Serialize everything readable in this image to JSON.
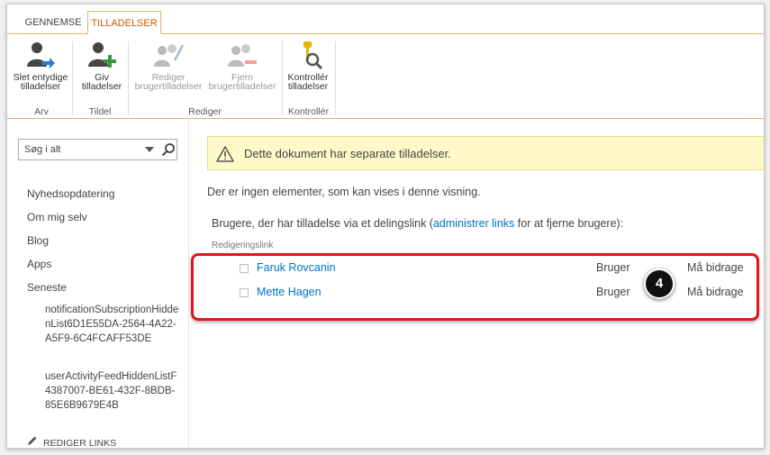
{
  "tabs": [
    {
      "label": "GENNEMSE"
    },
    {
      "label": "TILLADELSER"
    }
  ],
  "ribbon": {
    "buttons": [
      {
        "label": "Slet entydige\ntilladelser",
        "icon": "user-arrow-icon"
      },
      {
        "label": "Giv\ntilladelser",
        "icon": "user-add-icon"
      },
      {
        "label": "Rediger\nbrugertilladelser",
        "icon": "users-edit-icon"
      },
      {
        "label": "Fjern\nbrugertilladelser",
        "icon": "users-remove-icon"
      },
      {
        "label": "Kontrollér\ntilladelser",
        "icon": "key-search-icon"
      }
    ],
    "groups": [
      "Arv",
      "Tildel",
      "Rediger",
      "Kontrollér"
    ]
  },
  "search": {
    "placeholder": "Søg i alt"
  },
  "nav": {
    "items": [
      "Nyhedsopdatering",
      "Om mig selv",
      "Blog",
      "Apps",
      "Seneste"
    ],
    "sub_items": [
      "notificationSubscriptionHiddenList6D1E55DA-2564-4A22-A5F9-6C4FCAFF53DE",
      "userActivityFeedHiddenListF4387007-BE61-432F-8BDB-85E6B9679E4B"
    ],
    "edit_links": "REDIGER LINKS"
  },
  "main": {
    "banner": "Dette dokument har separate tilladelser.",
    "empty_message": "Der er ingen elementer, som kan vises i denne visning.",
    "users_prefix": "Brugere, der har tilladelse via et delingslink (",
    "users_link": "administrer links",
    "users_suffix": " for at fjerne brugere):",
    "section_label": "Redigeringslink",
    "users": [
      {
        "name": "Faruk Rovcanin",
        "role": "Bruger",
        "permission": "Må bidrage"
      },
      {
        "name": "Mette Hagen",
        "role": "Bruger",
        "permission": "Må bidrage"
      }
    ]
  },
  "annotation": {
    "step": "4"
  },
  "colors": {
    "accent": "#c75a00",
    "link": "#0072c6",
    "highlight": "#e0141e",
    "banner_bg": "#fff9c9"
  }
}
